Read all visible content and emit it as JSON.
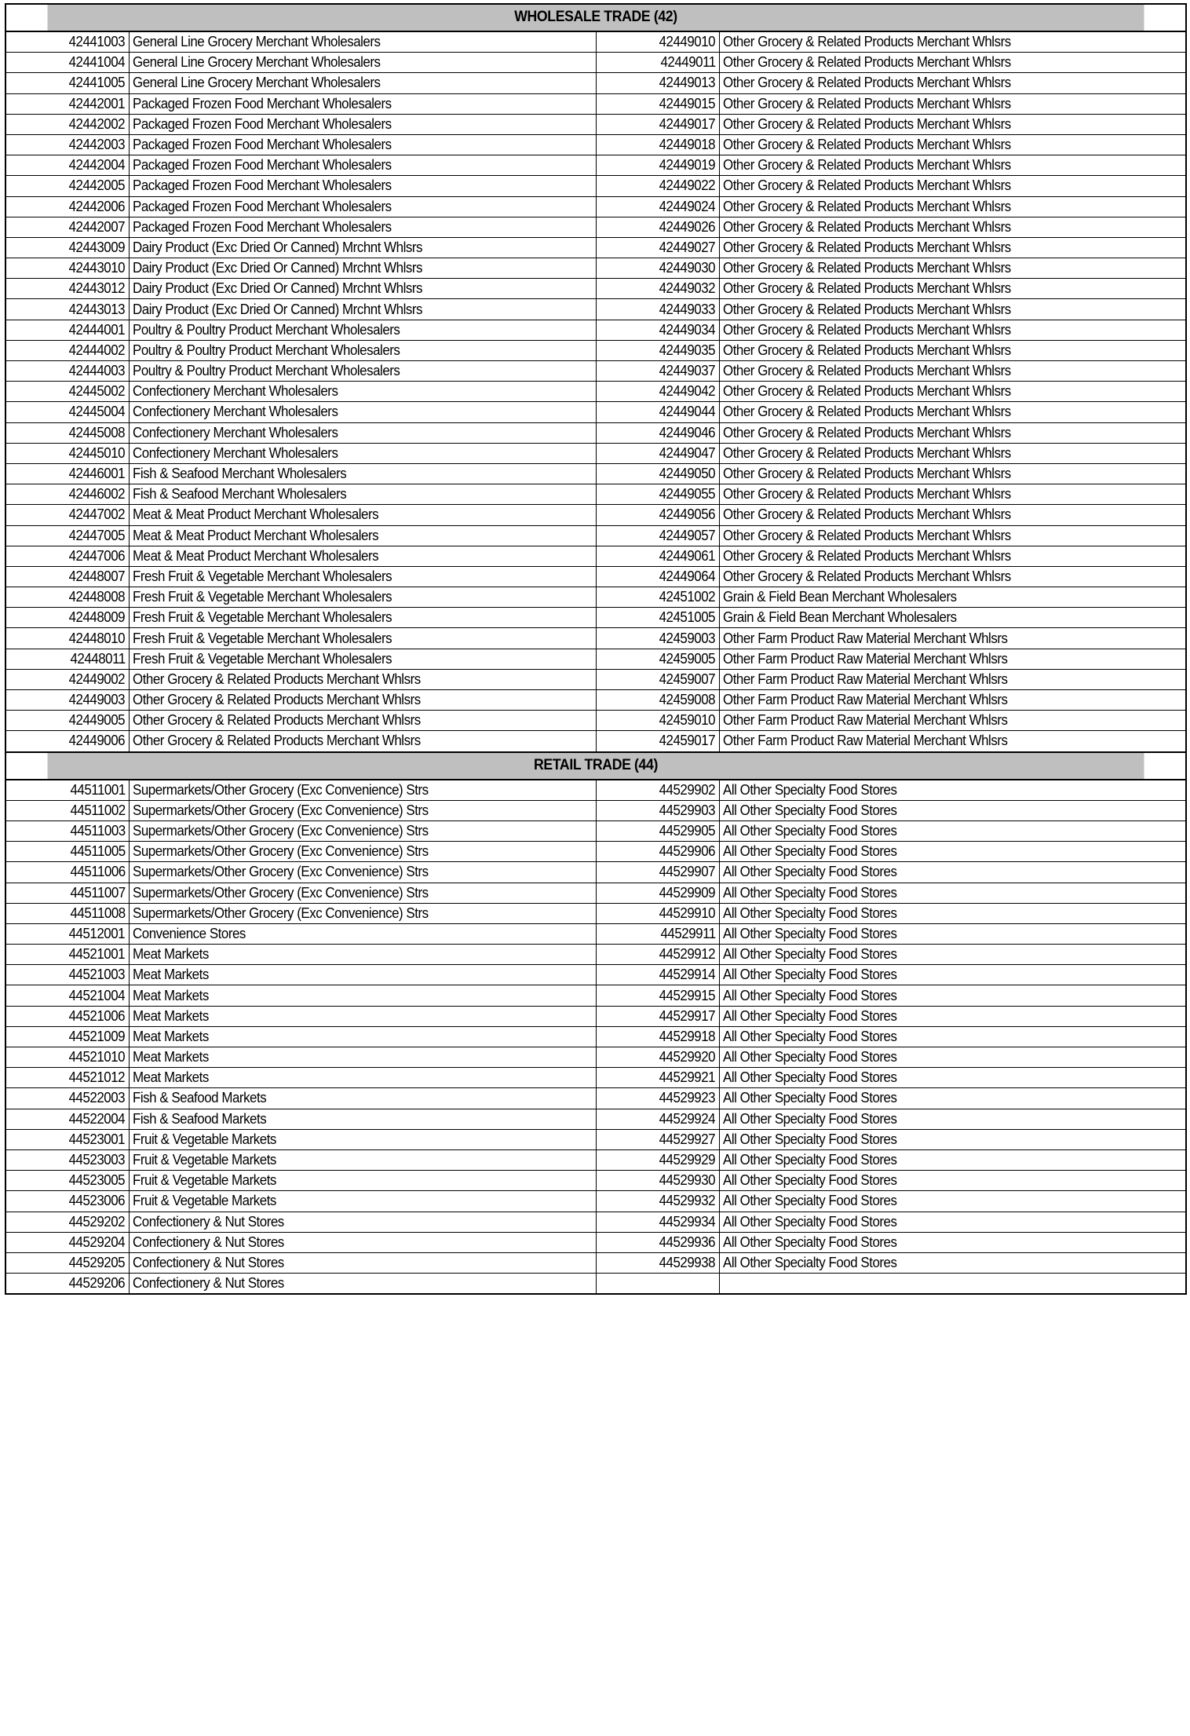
{
  "document": {
    "sections": [
      {
        "title": "WHOLESALE TRADE (42)",
        "rows": [
          {
            "left_code": "42441003",
            "left_desc": "General Line Grocery Merchant Wholesalers",
            "right_code": "42449010",
            "right_desc": "Other Grocery & Related Products Merchant Whlsrs"
          },
          {
            "left_code": "42441004",
            "left_desc": "General Line Grocery Merchant Wholesalers",
            "right_code": "42449011",
            "right_desc": "Other Grocery & Related Products Merchant Whlsrs"
          },
          {
            "left_code": "42441005",
            "left_desc": "General Line Grocery Merchant Wholesalers",
            "right_code": "42449013",
            "right_desc": "Other Grocery & Related Products Merchant Whlsrs"
          },
          {
            "left_code": "42442001",
            "left_desc": "Packaged Frozen Food Merchant Wholesalers",
            "right_code": "42449015",
            "right_desc": "Other Grocery & Related Products Merchant Whlsrs"
          },
          {
            "left_code": "42442002",
            "left_desc": "Packaged Frozen Food Merchant Wholesalers",
            "right_code": "42449017",
            "right_desc": "Other Grocery & Related Products Merchant Whlsrs"
          },
          {
            "left_code": "42442003",
            "left_desc": "Packaged Frozen Food Merchant Wholesalers",
            "right_code": "42449018",
            "right_desc": "Other Grocery & Related Products Merchant Whlsrs"
          },
          {
            "left_code": "42442004",
            "left_desc": "Packaged Frozen Food Merchant Wholesalers",
            "right_code": "42449019",
            "right_desc": "Other Grocery & Related Products Merchant Whlsrs"
          },
          {
            "left_code": "42442005",
            "left_desc": "Packaged Frozen Food Merchant Wholesalers",
            "right_code": "42449022",
            "right_desc": "Other Grocery & Related Products Merchant Whlsrs"
          },
          {
            "left_code": "42442006",
            "left_desc": "Packaged Frozen Food Merchant Wholesalers",
            "right_code": "42449024",
            "right_desc": "Other Grocery & Related Products Merchant Whlsrs"
          },
          {
            "left_code": "42442007",
            "left_desc": "Packaged Frozen Food Merchant Wholesalers",
            "right_code": "42449026",
            "right_desc": "Other Grocery & Related Products Merchant Whlsrs"
          },
          {
            "left_code": "42443009",
            "left_desc": "Dairy Product (Exc Dried Or Canned) Mrchnt Whlsrs",
            "right_code": "42449027",
            "right_desc": "Other Grocery & Related Products Merchant Whlsrs"
          },
          {
            "left_code": "42443010",
            "left_desc": "Dairy Product (Exc Dried Or Canned) Mrchnt Whlsrs",
            "right_code": "42449030",
            "right_desc": "Other Grocery & Related Products Merchant Whlsrs"
          },
          {
            "left_code": "42443012",
            "left_desc": "Dairy Product (Exc Dried Or Canned) Mrchnt Whlsrs",
            "right_code": "42449032",
            "right_desc": "Other Grocery & Related Products Merchant Whlsrs"
          },
          {
            "left_code": "42443013",
            "left_desc": "Dairy Product (Exc Dried Or Canned) Mrchnt Whlsrs",
            "right_code": "42449033",
            "right_desc": "Other Grocery & Related Products Merchant Whlsrs"
          },
          {
            "left_code": "42444001",
            "left_desc": "Poultry & Poultry Product Merchant Wholesalers",
            "right_code": "42449034",
            "right_desc": "Other Grocery & Related Products Merchant Whlsrs"
          },
          {
            "left_code": "42444002",
            "left_desc": "Poultry & Poultry Product Merchant Wholesalers",
            "right_code": "42449035",
            "right_desc": "Other Grocery & Related Products Merchant Whlsrs"
          },
          {
            "left_code": "42444003",
            "left_desc": "Poultry & Poultry Product Merchant Wholesalers",
            "right_code": "42449037",
            "right_desc": "Other Grocery & Related Products Merchant Whlsrs"
          },
          {
            "left_code": "42445002",
            "left_desc": "Confectionery Merchant Wholesalers",
            "right_code": "42449042",
            "right_desc": "Other Grocery & Related Products Merchant Whlsrs"
          },
          {
            "left_code": "42445004",
            "left_desc": "Confectionery Merchant Wholesalers",
            "right_code": "42449044",
            "right_desc": "Other Grocery & Related Products Merchant Whlsrs"
          },
          {
            "left_code": "42445008",
            "left_desc": "Confectionery Merchant Wholesalers",
            "right_code": "42449046",
            "right_desc": "Other Grocery & Related Products Merchant Whlsrs"
          },
          {
            "left_code": "42445010",
            "left_desc": "Confectionery Merchant Wholesalers",
            "right_code": "42449047",
            "right_desc": "Other Grocery & Related Products Merchant Whlsrs"
          },
          {
            "left_code": "42446001",
            "left_desc": "Fish & Seafood Merchant Wholesalers",
            "right_code": "42449050",
            "right_desc": "Other Grocery & Related Products Merchant Whlsrs"
          },
          {
            "left_code": "42446002",
            "left_desc": "Fish & Seafood Merchant Wholesalers",
            "right_code": "42449055",
            "right_desc": "Other Grocery & Related Products Merchant Whlsrs"
          },
          {
            "left_code": "42447002",
            "left_desc": "Meat & Meat Product Merchant Wholesalers",
            "right_code": "42449056",
            "right_desc": "Other Grocery & Related Products Merchant Whlsrs"
          },
          {
            "left_code": "42447005",
            "left_desc": "Meat & Meat Product Merchant Wholesalers",
            "right_code": "42449057",
            "right_desc": "Other Grocery & Related Products Merchant Whlsrs"
          },
          {
            "left_code": "42447006",
            "left_desc": "Meat & Meat Product Merchant Wholesalers",
            "right_code": "42449061",
            "right_desc": "Other Grocery & Related Products Merchant Whlsrs"
          },
          {
            "left_code": "42448007",
            "left_desc": "Fresh Fruit & Vegetable Merchant Wholesalers",
            "right_code": "42449064",
            "right_desc": "Other Grocery & Related Products Merchant Whlsrs"
          },
          {
            "left_code": "42448008",
            "left_desc": "Fresh Fruit & Vegetable Merchant Wholesalers",
            "right_code": "42451002",
            "right_desc": "Grain & Field Bean Merchant Wholesalers"
          },
          {
            "left_code": "42448009",
            "left_desc": "Fresh Fruit & Vegetable Merchant Wholesalers",
            "right_code": "42451005",
            "right_desc": "Grain & Field Bean Merchant Wholesalers"
          },
          {
            "left_code": "42448010",
            "left_desc": "Fresh Fruit & Vegetable Merchant Wholesalers",
            "right_code": "42459003",
            "right_desc": "Other Farm Product Raw Material Merchant Whlsrs"
          },
          {
            "left_code": "42448011",
            "left_desc": "Fresh Fruit & Vegetable Merchant Wholesalers",
            "right_code": "42459005",
            "right_desc": "Other Farm Product Raw Material Merchant Whlsrs"
          },
          {
            "left_code": "42449002",
            "left_desc": "Other Grocery & Related Products Merchant Whlsrs",
            "right_code": "42459007",
            "right_desc": "Other Farm Product Raw Material Merchant Whlsrs"
          },
          {
            "left_code": "42449003",
            "left_desc": "Other Grocery & Related Products Merchant Whlsrs",
            "right_code": "42459008",
            "right_desc": "Other Farm Product Raw Material Merchant Whlsrs"
          },
          {
            "left_code": "42449005",
            "left_desc": "Other Grocery & Related Products Merchant Whlsrs",
            "right_code": "42459010",
            "right_desc": "Other Farm Product Raw Material Merchant Whlsrs"
          },
          {
            "left_code": "42449006",
            "left_desc": "Other Grocery & Related Products Merchant Whlsrs",
            "right_code": "42459017",
            "right_desc": "Other Farm Product Raw Material Merchant Whlsrs"
          }
        ]
      },
      {
        "title": "RETAIL TRADE (44)",
        "rows": [
          {
            "left_code": "44511001",
            "left_desc": "Supermarkets/Other Grocery (Exc Convenience) Strs",
            "right_code": "44529902",
            "right_desc": "All Other Specialty Food Stores"
          },
          {
            "left_code": "44511002",
            "left_desc": "Supermarkets/Other Grocery (Exc Convenience) Strs",
            "right_code": "44529903",
            "right_desc": "All Other Specialty Food Stores"
          },
          {
            "left_code": "44511003",
            "left_desc": "Supermarkets/Other Grocery (Exc Convenience) Strs",
            "right_code": "44529905",
            "right_desc": "All Other Specialty Food Stores"
          },
          {
            "left_code": "44511005",
            "left_desc": "Supermarkets/Other Grocery (Exc Convenience) Strs",
            "right_code": "44529906",
            "right_desc": "All Other Specialty Food Stores"
          },
          {
            "left_code": "44511006",
            "left_desc": "Supermarkets/Other Grocery (Exc Convenience) Strs",
            "right_code": "44529907",
            "right_desc": "All Other Specialty Food Stores"
          },
          {
            "left_code": "44511007",
            "left_desc": "Supermarkets/Other Grocery (Exc Convenience) Strs",
            "right_code": "44529909",
            "right_desc": "All Other Specialty Food Stores"
          },
          {
            "left_code": "44511008",
            "left_desc": "Supermarkets/Other Grocery (Exc Convenience) Strs",
            "right_code": "44529910",
            "right_desc": "All Other Specialty Food Stores"
          },
          {
            "left_code": "44512001",
            "left_desc": "Convenience Stores",
            "right_code": "44529911",
            "right_desc": "All Other Specialty Food Stores"
          },
          {
            "left_code": "44521001",
            "left_desc": "Meat Markets",
            "right_code": "44529912",
            "right_desc": "All Other Specialty Food Stores"
          },
          {
            "left_code": "44521003",
            "left_desc": "Meat Markets",
            "right_code": "44529914",
            "right_desc": "All Other Specialty Food Stores"
          },
          {
            "left_code": "44521004",
            "left_desc": "Meat Markets",
            "right_code": "44529915",
            "right_desc": "All Other Specialty Food Stores"
          },
          {
            "left_code": "44521006",
            "left_desc": "Meat Markets",
            "right_code": "44529917",
            "right_desc": "All Other Specialty Food Stores"
          },
          {
            "left_code": "44521009",
            "left_desc": "Meat Markets",
            "right_code": "44529918",
            "right_desc": "All Other Specialty Food Stores"
          },
          {
            "left_code": "44521010",
            "left_desc": "Meat Markets",
            "right_code": "44529920",
            "right_desc": "All Other Specialty Food Stores"
          },
          {
            "left_code": "44521012",
            "left_desc": "Meat Markets",
            "right_code": "44529921",
            "right_desc": "All Other Specialty Food Stores"
          },
          {
            "left_code": "44522003",
            "left_desc": "Fish & Seafood Markets",
            "right_code": "44529923",
            "right_desc": "All Other Specialty Food Stores"
          },
          {
            "left_code": "44522004",
            "left_desc": "Fish & Seafood Markets",
            "right_code": "44529924",
            "right_desc": "All Other Specialty Food Stores"
          },
          {
            "left_code": "44523001",
            "left_desc": "Fruit & Vegetable Markets",
            "right_code": "44529927",
            "right_desc": "All Other Specialty Food Stores"
          },
          {
            "left_code": "44523003",
            "left_desc": "Fruit & Vegetable Markets",
            "right_code": "44529929",
            "right_desc": "All Other Specialty Food Stores"
          },
          {
            "left_code": "44523005",
            "left_desc": "Fruit & Vegetable Markets",
            "right_code": "44529930",
            "right_desc": "All Other Specialty Food Stores"
          },
          {
            "left_code": "44523006",
            "left_desc": "Fruit & Vegetable Markets",
            "right_code": "44529932",
            "right_desc": "All Other Specialty Food Stores"
          },
          {
            "left_code": "44529202",
            "left_desc": "Confectionery & Nut Stores",
            "right_code": "44529934",
            "right_desc": "All Other Specialty Food Stores"
          },
          {
            "left_code": "44529204",
            "left_desc": "Confectionery & Nut Stores",
            "right_code": "44529936",
            "right_desc": "All Other Specialty Food Stores"
          },
          {
            "left_code": "44529205",
            "left_desc": "Confectionery & Nut Stores",
            "right_code": "44529938",
            "right_desc": "All Other Specialty Food Stores"
          },
          {
            "left_code": "44529206",
            "left_desc": "Confectionery & Nut Stores",
            "right_code": "",
            "right_desc": ""
          }
        ]
      }
    ],
    "colors": {
      "section_header_background": "#bfbfbf",
      "border": "#000000",
      "text": "#000000",
      "page_background": "#ffffff"
    }
  }
}
